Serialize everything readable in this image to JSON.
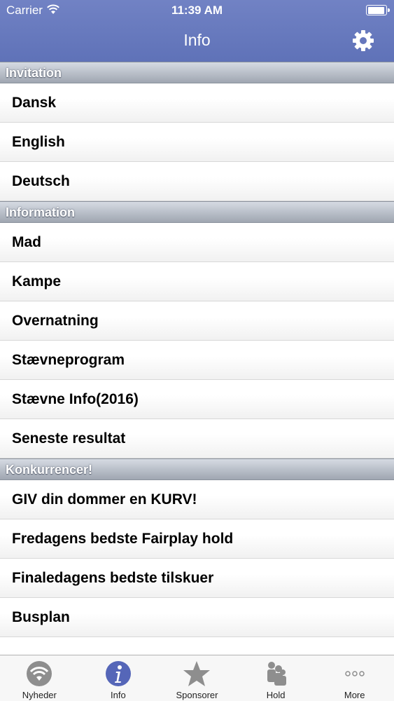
{
  "status": {
    "carrier": "Carrier",
    "time": "11:39 AM"
  },
  "nav": {
    "title": "Info",
    "settings_icon": "gear-icon"
  },
  "sections": [
    {
      "header": "Invitation",
      "items": [
        "Dansk",
        "English",
        "Deutsch"
      ]
    },
    {
      "header": "Information",
      "items": [
        "Mad",
        "Kampe",
        "Overnatning",
        "Stævneprogram",
        "Stævne Info(2016)",
        "Seneste resultat"
      ]
    },
    {
      "header": "Konkurrencer!",
      "items": [
        "GIV din dommer en KURV!",
        "Fredagens bedste Fairplay hold",
        "Finaledagens bedste tilskuer",
        "Busplan"
      ]
    }
  ],
  "tabs": [
    {
      "label": "Nyheder",
      "icon": "wifi-news-icon"
    },
    {
      "label": "Info",
      "icon": "info-icon"
    },
    {
      "label": "Sponsorer",
      "icon": "star-icon"
    },
    {
      "label": "Hold",
      "icon": "people-icon"
    },
    {
      "label": "More",
      "icon": "more-icon"
    }
  ],
  "colors": {
    "nav_bar": "#6677bd",
    "tab_active": "#5566b8",
    "tab_inactive": "#8e8e8e"
  }
}
